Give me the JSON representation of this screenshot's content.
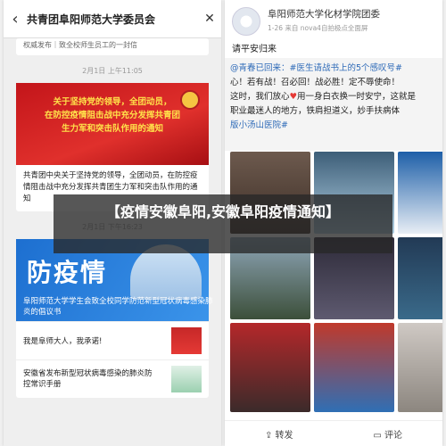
{
  "left": {
    "header_title": "共青团阜阳师范大学委员会",
    "top_text": "权威发布｜致全校师生员工的一封信",
    "time1": "2月1日 上午11:05",
    "banner1": [
      "关于坚持党的领导，全团动员，",
      "在防控疫情阻击战中充分发挥共青团",
      "生力军和突击队作用的通知"
    ],
    "banner1_caption": "共青团中央关于坚持党的领导，全团动员，在防控疫情阻击战中充分发挥共青团生力军和突击队作用的通知",
    "time2": "2月1日 下午16:23",
    "banner2_big": "防疫情",
    "banner2_caption": "阜阳师范大学学生会致全校同学防范新型冠状病毒感染肺炎的倡议书",
    "list": [
      {
        "text": "我是阜师大人，我承诺!"
      },
      {
        "text": "安徽省发布新型冠状病毒感染的肺炎防控常识手册"
      }
    ]
  },
  "right": {
    "name": "阜阳师范大学化材学院团委",
    "meta": "1-26  来自 nova4自拍极点全面屏",
    "post_text": "请平安归来",
    "quote_line1_prefix": "@青春已回来：",
    "quote_line1_tag": "#医生请战书上的5个感叹号#",
    "quote_line2": "心！若有战！召必回！战必胜！定不辱使命！",
    "quote_line3": "这时，我们放心",
    "quote_line3b": "用一身白衣换一时安宁，这就是",
    "quote_line4": "职业最迷人的地方，铁肩担道义，妙手扶病体",
    "quote_line5": "版小汤山医院#",
    "share_label": "转发",
    "comment_label": "评论"
  },
  "overlay_title": "【疫情安徽阜阳,安徽阜阳疫情通知】",
  "colors": {
    "red_banner": "#d0221f",
    "blue_banner": "#2a7fe0",
    "link_blue": "#2f6bb8"
  }
}
